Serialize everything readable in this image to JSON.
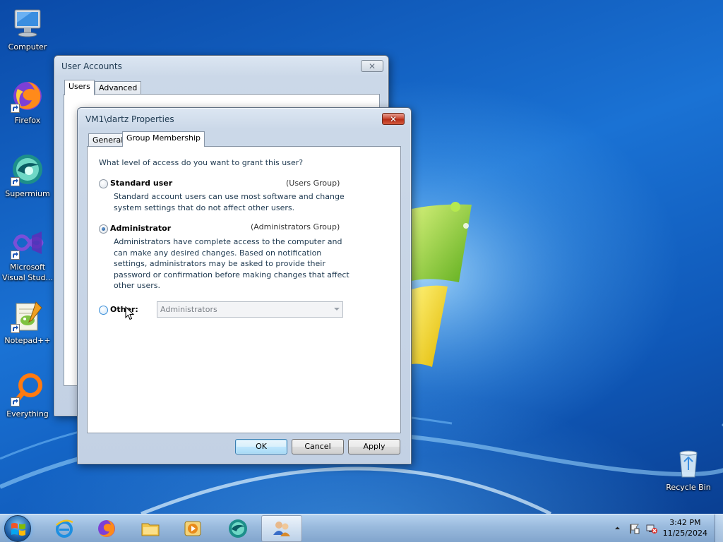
{
  "desktop": {
    "icons": [
      {
        "label": "Computer",
        "icon": "computer-icon"
      },
      {
        "label": "Firefox",
        "icon": "firefox-icon"
      },
      {
        "label": "Supermium",
        "icon": "supermium-icon"
      },
      {
        "label": "Microsoft Visual Stud...",
        "icon": "visual-studio-icon"
      },
      {
        "label": "Notepad++",
        "icon": "notepad-plus-plus-icon"
      },
      {
        "label": "Everything",
        "icon": "everything-search-icon"
      },
      {
        "label": "Recycle Bin",
        "icon": "recycle-bin-icon"
      }
    ]
  },
  "user_accounts_window": {
    "title": "User Accounts",
    "tabs": [
      "Users",
      "Advanced"
    ],
    "selected_tab": "Users",
    "close_glyph": "✕"
  },
  "properties_dialog": {
    "title": "VM1\\dartz Properties",
    "tabs": [
      "General",
      "Group Membership"
    ],
    "selected_tab": "Group Membership",
    "close_glyph": "✕",
    "question": "What level of access do you want to grant this user?",
    "options": {
      "standard": {
        "title": "Standard user",
        "group": "(Users Group)",
        "description": "Standard account users can use most software and change system settings that do not affect other users.",
        "checked": false
      },
      "administrator": {
        "title": "Administrator",
        "group": "(Administrators Group)",
        "description": "Administrators have complete access to the computer and can make any desired changes. Based on notification settings, administrators may be asked to provide their password or confirmation before making changes that affect other users.",
        "checked": true
      },
      "other": {
        "title": "Other:",
        "checked": false,
        "combo_value": "Administrators",
        "combo_enabled": false
      }
    },
    "buttons": {
      "ok": "OK",
      "cancel": "Cancel",
      "apply": "Apply"
    }
  },
  "taskbar": {
    "apps": [
      {
        "name": "internet-explorer-icon",
        "active": false
      },
      {
        "name": "firefox-icon",
        "active": false
      },
      {
        "name": "file-explorer-icon",
        "active": false
      },
      {
        "name": "media-player-icon",
        "active": false
      },
      {
        "name": "supermium-icon",
        "active": false
      },
      {
        "name": "user-accounts-icon",
        "active": true
      }
    ],
    "tray": {
      "time": "3:42 PM",
      "date": "11/25/2024"
    }
  },
  "colors": {
    "desktop_blue": "#1a6fc9",
    "window_frame": "#c3d1e4",
    "close_button_red": "#c8442e",
    "default_button_blue": "#bee6fd",
    "text_blue": "#1e3950"
  }
}
